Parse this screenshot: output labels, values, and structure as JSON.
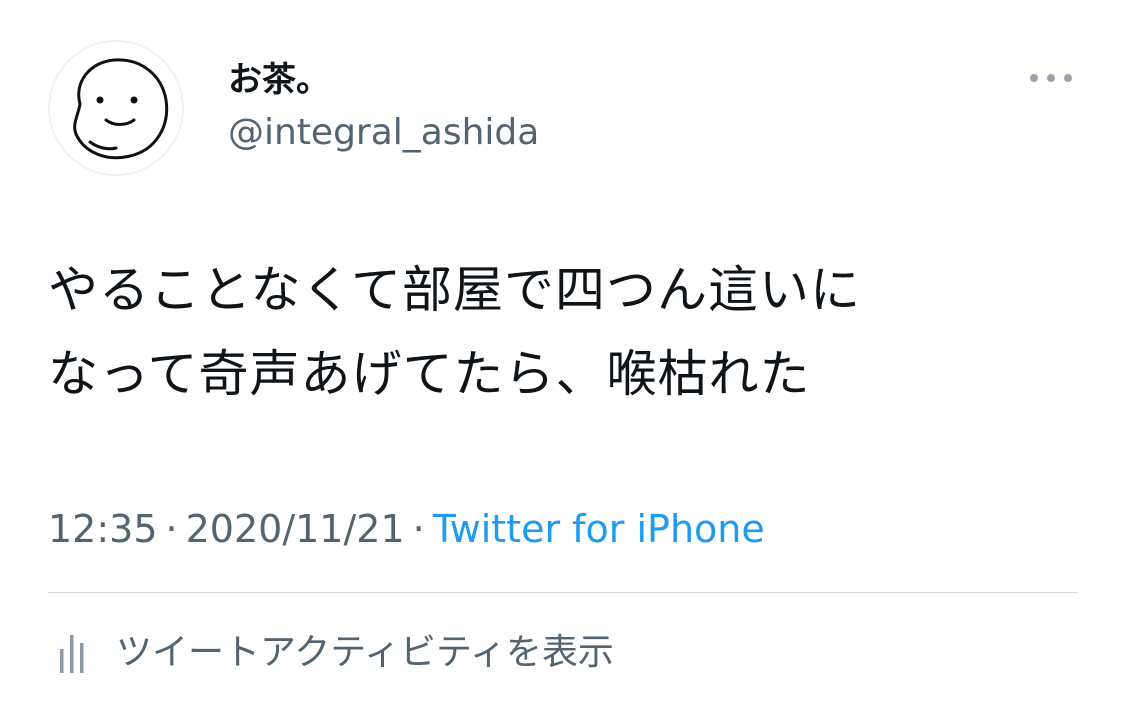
{
  "tweet": {
    "author": {
      "display_name": "お茶。",
      "handle": "@integral_ashida",
      "avatar": "hand-drawn-smiley-face"
    },
    "text_lines": [
      "やることなくて部屋で四つん這いに",
      "なって奇声あげてたら、喉枯れた"
    ],
    "time": "12:35",
    "separator": "·",
    "date": "2020/11/21",
    "source": "Twitter for iPhone",
    "more_icon": "more-horizontal-icon",
    "activity": {
      "icon": "bar-chart-icon",
      "label": "ツイートアクティビティを表示"
    }
  },
  "colors": {
    "text_primary": "#0f1419",
    "text_secondary": "#536471",
    "link": "#1d9bf0",
    "divider": "#cfd9de"
  }
}
